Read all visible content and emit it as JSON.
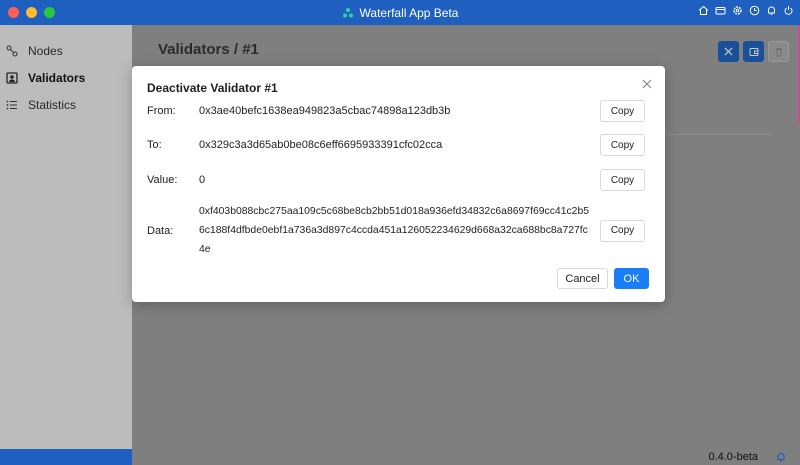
{
  "app": {
    "title": "Waterfall App Beta",
    "brand_color": "#1f5fbf",
    "version": "0.4.0-beta"
  },
  "sidebar": {
    "items": [
      {
        "label": "Nodes",
        "icon": "nodes-icon",
        "active": false
      },
      {
        "label": "Validators",
        "icon": "validators-icon",
        "active": true
      },
      {
        "label": "Statistics",
        "icon": "list-icon",
        "active": false
      }
    ]
  },
  "page": {
    "title": "Validators",
    "separator": "/",
    "id": "#1"
  },
  "modal": {
    "title": "Deactivate Validator #1",
    "rows": [
      {
        "label": "From:",
        "value": "0x3ae40befc1638ea949823a5cbac74898a123db3b",
        "copy_label": "Copy"
      },
      {
        "label": "To:",
        "value": "0x329c3a3d65ab0be08c6eff6695933391cfc02cca",
        "copy_label": "Copy"
      },
      {
        "label": "Value:",
        "value": "0",
        "copy_label": "Copy"
      },
      {
        "label": "Data:",
        "value": "0xf403b088cbc275aa109c5c68be8cb2bb51d018a936efd34832c6a8697f69cc41c2b56c188f4dfbde0ebf1a736a3d897c4ccda451a126052234629d668a32ca688bc8a727fc4e",
        "copy_label": "Copy"
      }
    ],
    "cancel_label": "Cancel",
    "ok_label": "OK",
    "ok_color": "#1a7ff7"
  }
}
